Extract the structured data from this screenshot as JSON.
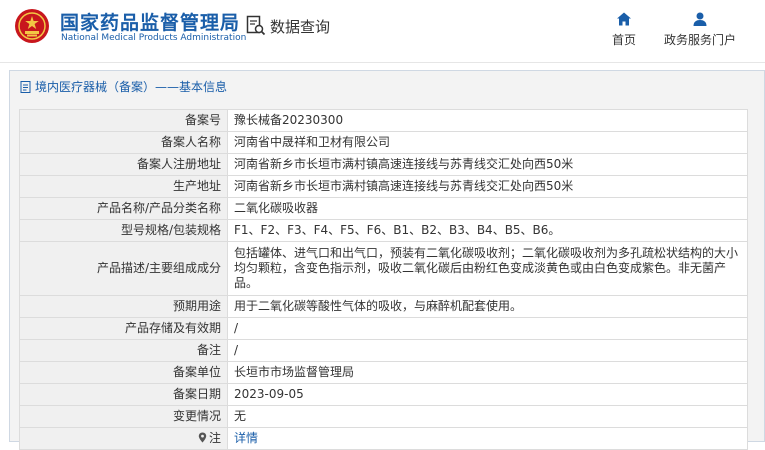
{
  "header": {
    "brand_cn": "国家药品监督管理局",
    "brand_en": "National Medical Products Administration",
    "search_label": "数据查询",
    "nav": [
      {
        "label": "首页",
        "icon": "home-icon"
      },
      {
        "label": "政务服务门户",
        "icon": "user-icon"
      }
    ]
  },
  "colors": {
    "brand": "#1a5ea9",
    "emblem": "#c8161d",
    "gold": "#f2c744"
  },
  "panel": {
    "title": "境内医疗器械（备案）——基本信息"
  },
  "rows": [
    {
      "key": "备案号",
      "value": "豫长械备20230300"
    },
    {
      "key": "备案人名称",
      "value": "河南省中晟祥和卫材有限公司"
    },
    {
      "key": "备案人注册地址",
      "value": "河南省新乡市长垣市满村镇高速连接线与苏青线交汇处向西50米"
    },
    {
      "key": "生产地址",
      "value": "河南省新乡市长垣市满村镇高速连接线与苏青线交汇处向西50米"
    },
    {
      "key": "产品名称/产品分类名称",
      "value": "二氧化碳吸收器"
    },
    {
      "key": "型号规格/包装规格",
      "value": "F1、F2、F3、F4、F5、F6、B1、B2、B3、B4、B5、B6。"
    },
    {
      "key": "产品描述/主要组成成分",
      "value": "包括罐体、进气口和出气口，预装有二氧化碳吸收剂；二氧化碳吸收剂为多孔疏松状结构的大小均匀颗粒，含变色指示剂，吸收二氧化碳后由粉红色变成淡黄色或由白色变成紫色。非无菌产品。"
    },
    {
      "key": "预期用途",
      "value": "用于二氧化碳等酸性气体的吸收，与麻醉机配套使用。"
    },
    {
      "key": "产品存储及有效期",
      "value": "/"
    },
    {
      "key": "备注",
      "value": "/"
    },
    {
      "key": "备案单位",
      "value": "长垣市市场监督管理局"
    },
    {
      "key": "备案日期",
      "value": "2023-09-05"
    },
    {
      "key": "变更情况",
      "value": "无"
    },
    {
      "key": "注",
      "value": "详情",
      "icon": "pin-icon"
    }
  ]
}
